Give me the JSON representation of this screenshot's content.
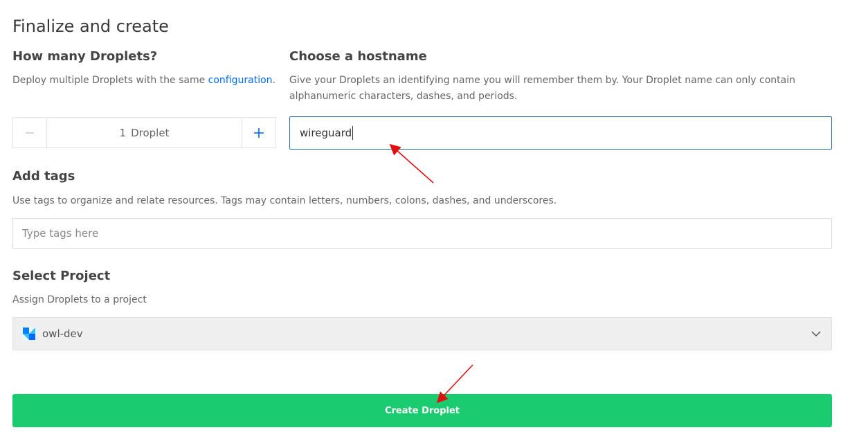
{
  "title": "Finalize and create",
  "droplets": {
    "heading": "How many Droplets?",
    "description_prefix": "Deploy multiple Droplets with the same ",
    "description_link": "configuration",
    "description_suffix": ".",
    "count_value": "1",
    "count_unit": "Droplet",
    "minus_icon": "minus-icon",
    "plus_icon": "plus-icon"
  },
  "hostname": {
    "heading": "Choose a hostname",
    "description_line1": "Give your Droplets an identifying name you will remember them by. Your Droplet name can only contain",
    "description_line2": "alphanumeric characters, dashes, and periods.",
    "value": "wireguard"
  },
  "tags": {
    "heading": "Add tags",
    "description": "Use tags to organize and relate resources. Tags may contain letters, numbers, colons, dashes, and underscores.",
    "placeholder": "Type tags here"
  },
  "project": {
    "heading": "Select Project",
    "description": "Assign Droplets to a project",
    "selected": "owl-dev",
    "icon": "project-icon"
  },
  "create_button": {
    "label": "Create Droplet"
  },
  "colors": {
    "accent_link": "#0069ff",
    "create_button": "#1bcb6f",
    "annotation_arrow": "#e01010",
    "plus_icon": "#0069ff"
  }
}
